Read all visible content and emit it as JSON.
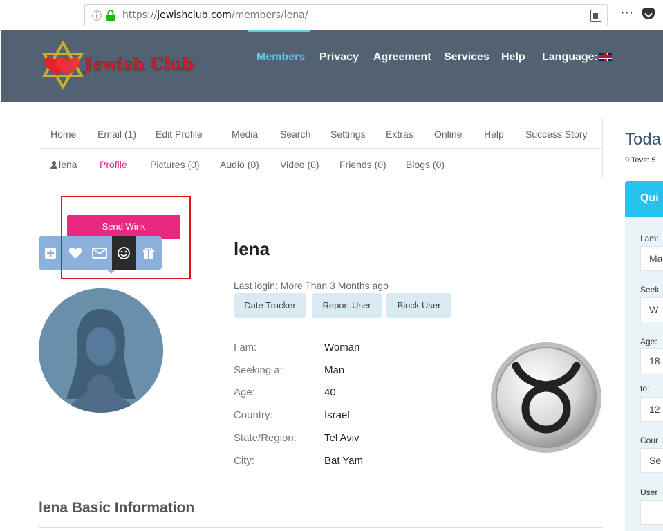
{
  "browser": {
    "url_prefix": "https://",
    "url_domain": "jewishclub.com",
    "url_path": "/members/lena/",
    "more_glyph": "···"
  },
  "header": {
    "logo_text": "Jewish Club",
    "nav": [
      "Members",
      "Privacy",
      "Agreement",
      "Services",
      "Help"
    ],
    "language_label": "Language:"
  },
  "menu": {
    "row1": [
      "Home",
      "Email (1)",
      "Edit Profile",
      "Media",
      "Search",
      "Settings",
      "Extras",
      "Online",
      "Help",
      "Success Story"
    ],
    "row2": [
      "lena",
      "Profile",
      "Pictures (0)",
      "Audio (0)",
      "Video (0)",
      "Friends (0)",
      "Blogs (0)"
    ]
  },
  "actions": {
    "tooltip": "Send Wink",
    "icons": [
      "plus-icon",
      "heart-icon",
      "envelope-icon",
      "smiley-icon",
      "gift-icon"
    ]
  },
  "profile": {
    "name": "lena",
    "last_login": "Last login: More Than 3 Months ago",
    "buttons": [
      "Date Tracker",
      "Report User",
      "Block User"
    ],
    "details": [
      {
        "label": "I am:",
        "value": "Woman"
      },
      {
        "label": "Seeking a:",
        "value": "Man"
      },
      {
        "label": "Age:",
        "value": "40"
      },
      {
        "label": "Country:",
        "value": "Israel"
      },
      {
        "label": "State/Region:",
        "value": "Tel Aviv"
      },
      {
        "label": "City:",
        "value": "Bat Yam"
      }
    ],
    "zodiac_icon": "taurus-icon",
    "section_title": "lena Basic Information"
  },
  "sidebar": {
    "today_title": "Toda",
    "today_date": "9 Tevet 5",
    "quick_title": "Qui",
    "fields": [
      {
        "label": "I am:",
        "value": "Ma"
      },
      {
        "label": "Seek",
        "value": "W"
      },
      {
        "label": "Age:",
        "value": "18"
      },
      {
        "label": "to:",
        "value": "12"
      },
      {
        "label": "Cour",
        "value": "Se"
      },
      {
        "label": "User",
        "value": ""
      }
    ]
  },
  "colors": {
    "header_bg": "#536272",
    "accent": "#62c9ef",
    "pink": "#e9287f",
    "action_bar": "#8ab0db",
    "highlight": "#e1121f"
  }
}
